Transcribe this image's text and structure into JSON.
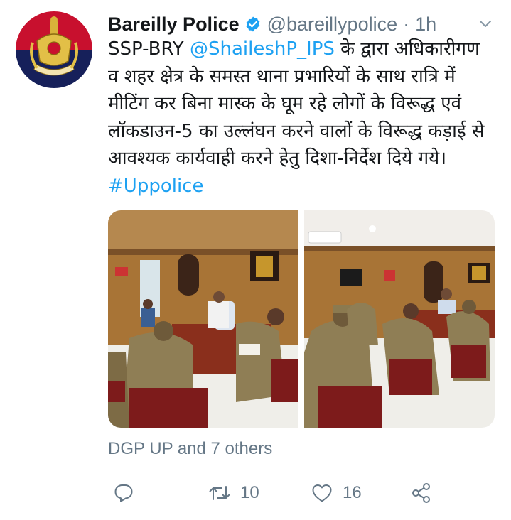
{
  "tweet": {
    "author_name": "Bareilly Police",
    "handle": "@bareillypolice",
    "separator": "·",
    "time": "1h",
    "text_prefix": "SSP-BRY ",
    "mention": "@ShaileshP_IPS",
    "text_body": " के द्वारा अधिकारीगण व शहर क्षेत्र के समस्त थाना प्रभारियों के साथ रात्रि में मीटिंग कर बिना मास्क के घूम रहे लोगों के विरूद्ध एवं लॉकडाउन-5 का उल्लंघन करने वालों के विरूद्ध कड़ाई से आवश्यक कार्यवाही करने हेतु दिशा-निर्देश दिये गये। ",
    "hashtag": "#Uppolice",
    "likers": "DGP UP and 7 others",
    "retweets": "10",
    "likes": "16"
  },
  "colors": {
    "link": "#1da1f2",
    "verified": "#1da1f2",
    "secondary_text": "#657786",
    "avatar_red": "#c8102e",
    "avatar_navy": "#16205a"
  },
  "icons": {
    "verified": "verified-badge-icon",
    "menu": "chevron-down-icon",
    "reply": "reply-icon",
    "retweet": "retweet-icon",
    "like": "heart-icon",
    "share": "share-icon"
  }
}
